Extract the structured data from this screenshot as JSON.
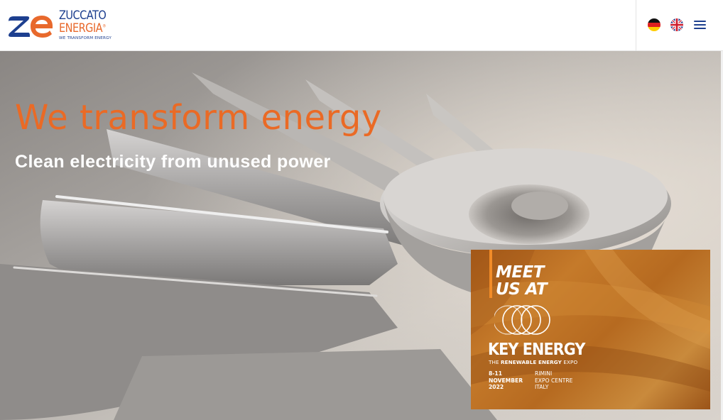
{
  "brand": {
    "name_line1": "ZUCCATO",
    "name_line2": "ENERGIA",
    "registered_mark": "®",
    "tagline": "WE TRANSFORM ENERGY",
    "colors": {
      "blue": "#1d3f8f",
      "orange": "#e8692c"
    }
  },
  "header": {
    "languages": [
      {
        "code": "de",
        "icon": "germany-flag-icon"
      },
      {
        "code": "en",
        "icon": "uk-flag-icon"
      }
    ],
    "menu_icon": "hamburger-menu-icon"
  },
  "hero": {
    "title": "We transform energy",
    "subtitle": "Clean electricity from unused power",
    "title_color": "#ea6a25",
    "background": "turbine-impeller-photo"
  },
  "promo": {
    "meet_line1": "MEET",
    "meet_line2": "US AT",
    "event_name": "KEY ENERGY",
    "tag_pre": "THE ",
    "tag_bold": "RENEWABLE ENERGY",
    "tag_post": " EXPO",
    "date_line1": "8-11",
    "date_line2": "NOVEMBER",
    "date_line3": "2022",
    "place_line1": "RIMINI",
    "place_line2": "EXPO CENTRE",
    "place_line3": "ITALY",
    "accent": "#f28c28"
  }
}
